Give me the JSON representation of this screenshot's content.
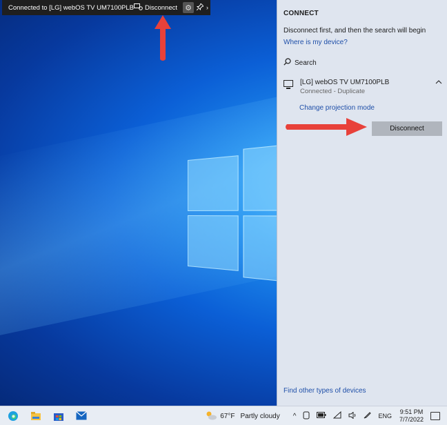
{
  "connection_bar": {
    "title": "Connected to [LG] webOS TV UM7100PLB",
    "disconnect_label": "Disconnect",
    "icons": [
      "disconnect-icon",
      "gear-icon",
      "pin-icon",
      "chevron-right-icon"
    ]
  },
  "panel": {
    "header": "CONNECT",
    "message": "Disconnect first, and then the search will begin",
    "where_link": "Where is my device?",
    "search_label": "Search",
    "device": {
      "name": "[LG] webOS TV UM7100PLB",
      "status": "Connected - Duplicate"
    },
    "change_projection_link": "Change projection mode",
    "disconnect_button": "Disconnect",
    "find_other_link": "Find other types of devices"
  },
  "taskbar": {
    "apps": [
      "start-icon",
      "edge-icon",
      "file-explorer-icon",
      "store-icon",
      "mail-icon"
    ],
    "weather": {
      "temp": "67°F",
      "condition": "Partly cloudy"
    },
    "language": "ENG",
    "time": "9:51 PM",
    "date": "7/7/2022"
  },
  "colors": {
    "accent_link": "#1f4fa8",
    "arrow": "#e8413a",
    "panel_bg": "#dfe5ef"
  }
}
